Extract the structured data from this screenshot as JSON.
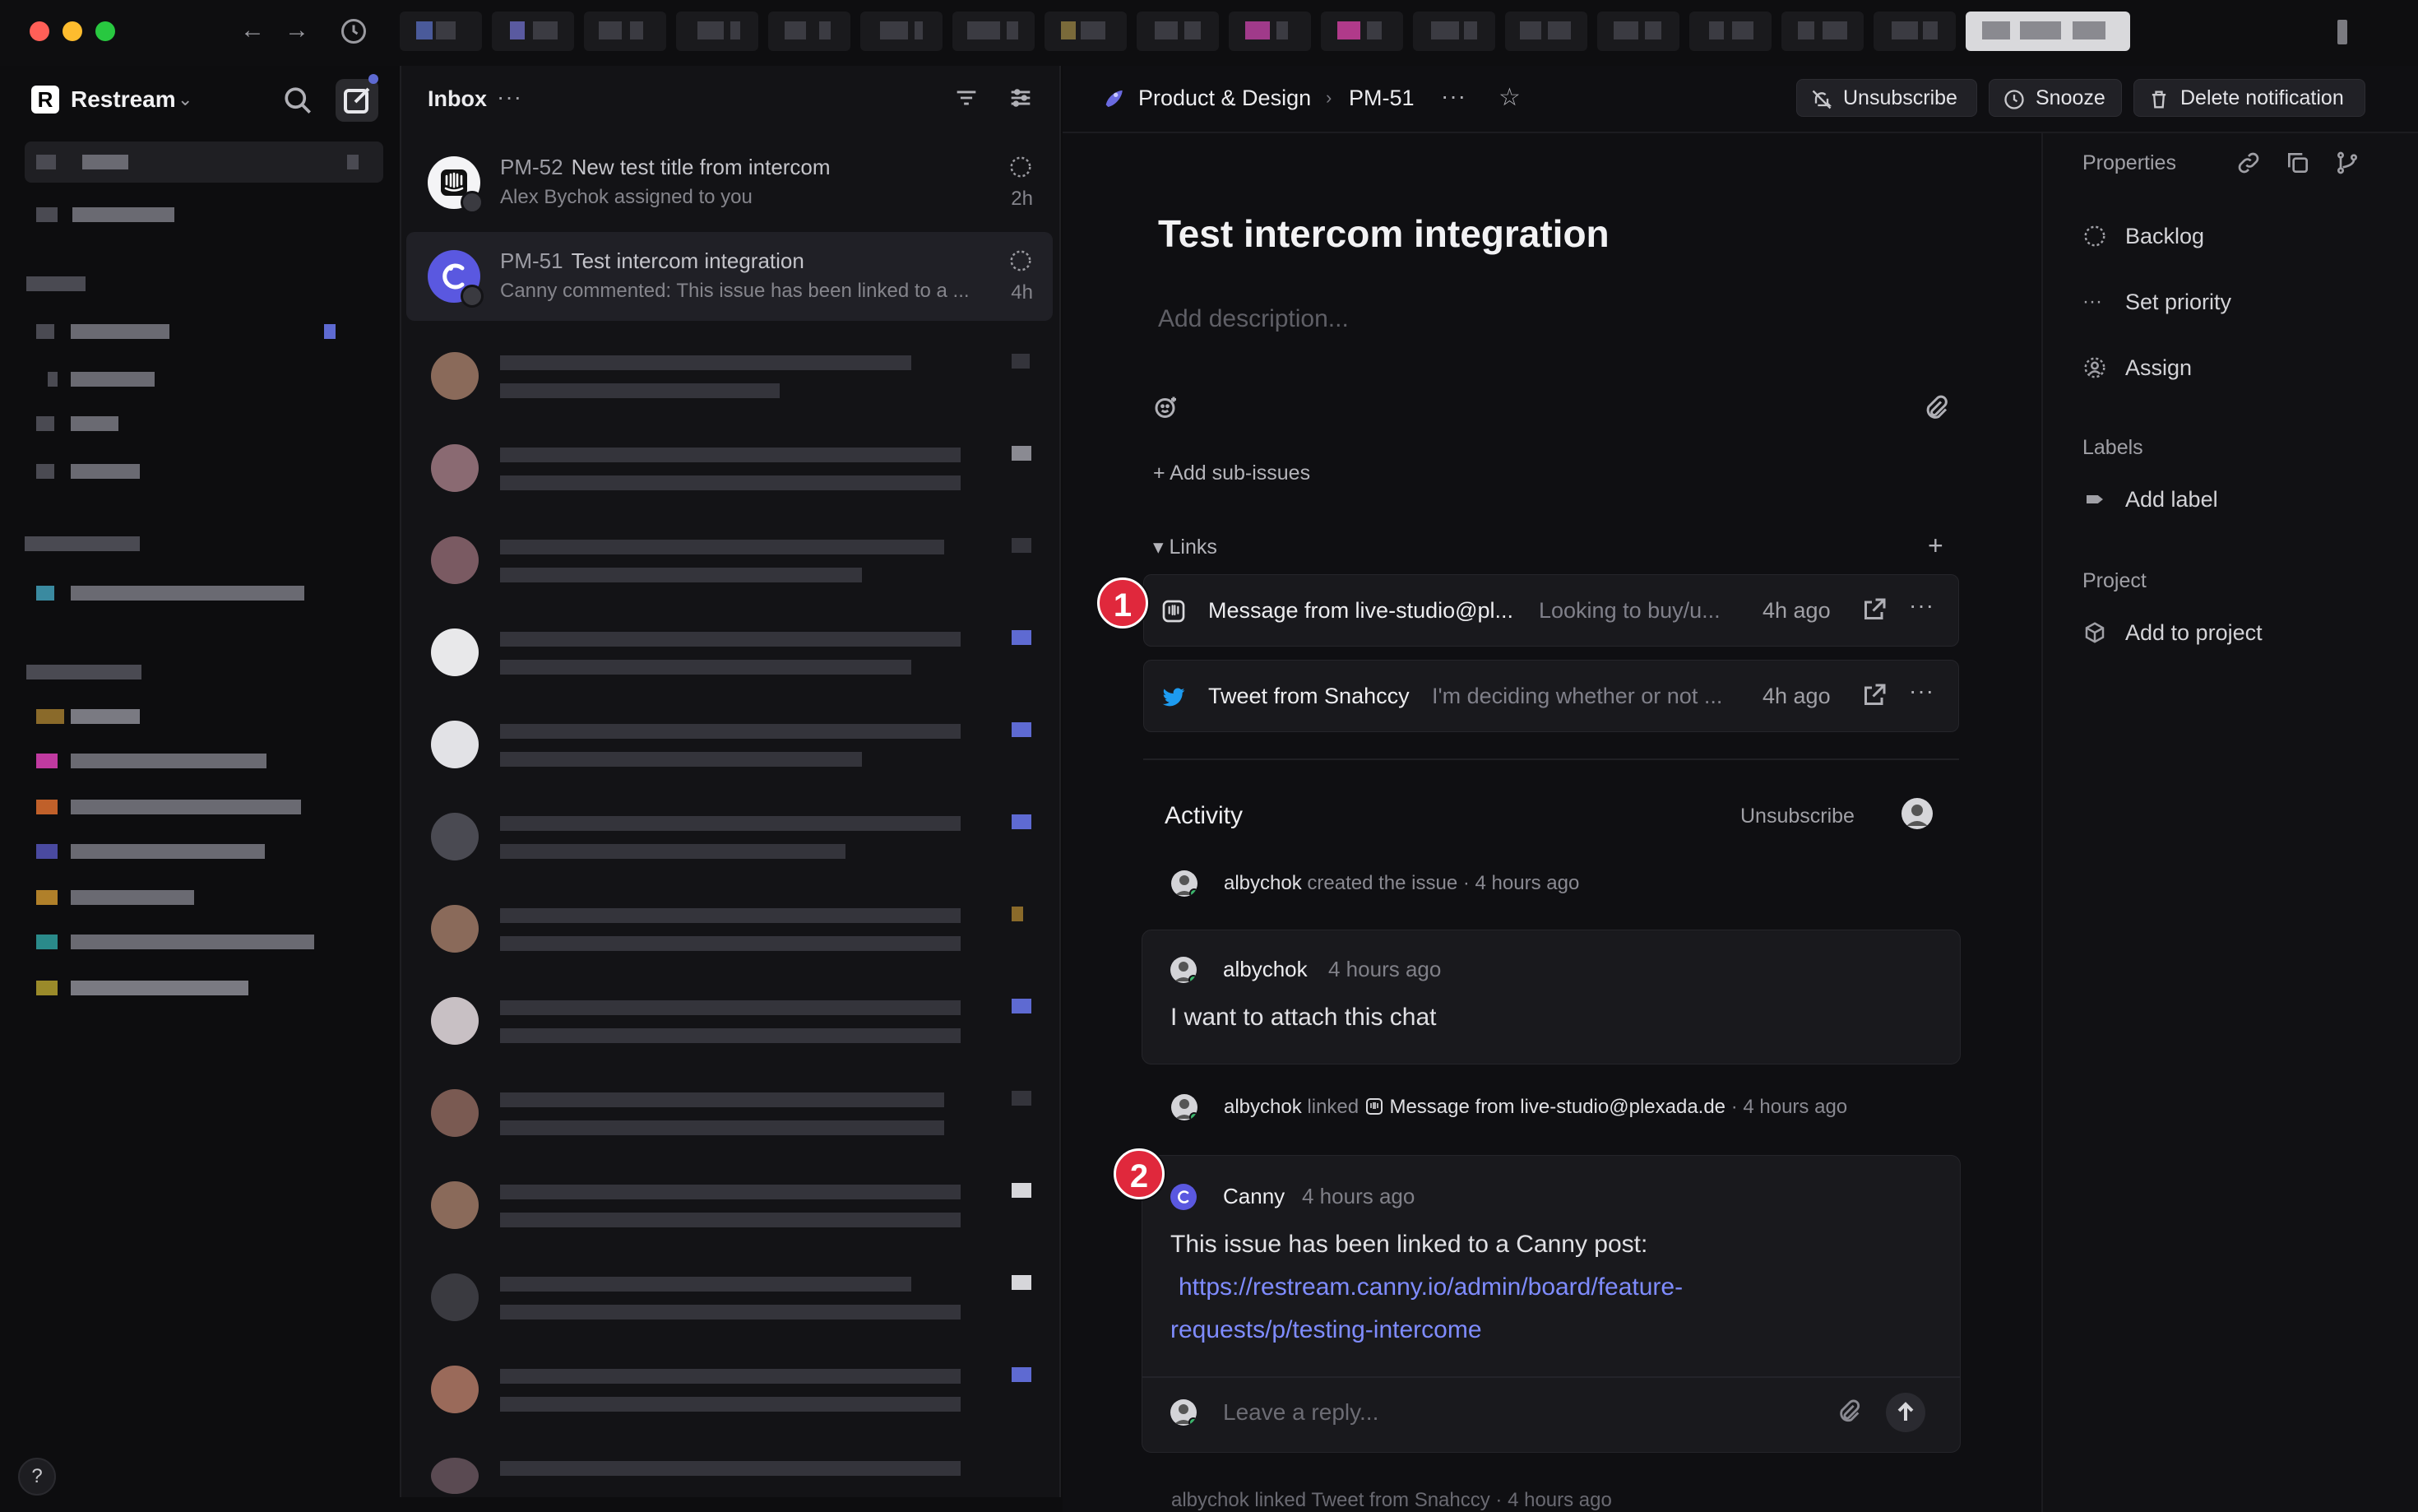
{
  "sidebar": {
    "workspace_initial": "R",
    "workspace_name": "Restream",
    "help_label": "?"
  },
  "inbox": {
    "title": "Inbox",
    "more_label": "···",
    "items": [
      {
        "id": "PM-52",
        "title": "New test title from intercom",
        "subtitle": "Alex Bychok assigned to you",
        "time": "2h"
      },
      {
        "id": "PM-51",
        "title": "Test intercom integration",
        "subtitle": "Canny commented: This issue has been linked to a ...",
        "time": "4h"
      }
    ]
  },
  "issue": {
    "breadcrumb_team": "Product & Design",
    "breadcrumb_sep": "›",
    "breadcrumb_id": "PM-51",
    "more_label": "···",
    "actions": {
      "unsubscribe": "Unsubscribe",
      "snooze": "Snooze",
      "delete": "Delete notification"
    },
    "title": "Test intercom integration",
    "description_placeholder": "Add description...",
    "add_sub_issues": "+ Add sub-issues",
    "links_header": "▾ Links",
    "links_add": "+",
    "links": [
      {
        "title": "Message from live-studio@pl...",
        "subtitle": "Looking to buy/u...",
        "time": "4h ago"
      },
      {
        "title": "Tweet from Snahccy",
        "subtitle": "I'm deciding whether or not ...",
        "time": "4h ago"
      }
    ],
    "markers": [
      "1",
      "2"
    ],
    "activity": {
      "title": "Activity",
      "unsubscribe": "Unsubscribe",
      "created": {
        "user": "albychok",
        "action": "created the issue",
        "dot": "·",
        "time": "4 hours ago"
      },
      "comment1": {
        "user": "albychok",
        "time": "4 hours ago",
        "body": "I want to attach this chat"
      },
      "linked": {
        "user": "albychok",
        "action": "linked",
        "target": "Message from live-studio@plexada.de",
        "dot": "·",
        "time": "4 hours ago"
      },
      "comment2": {
        "user": "Canny",
        "time": "4 hours ago",
        "body": "This issue has been linked to a Canny post:",
        "link_line1": "https://restream.canny.io/admin/board/feature-",
        "link_line2": "requests/p/testing-intercome"
      },
      "reply_placeholder": "Leave a reply...",
      "next_row": "albychok linked  Tweet from Snahccy · 4 hours ago"
    }
  },
  "properties": {
    "title": "Properties",
    "status": "Backlog",
    "priority": "Set priority",
    "assign": "Assign",
    "labels_title": "Labels",
    "add_label": "Add label",
    "project_title": "Project",
    "add_to_project": "Add to project"
  },
  "colors": {
    "accent": "#5e6ad2",
    "marker": "#e0283c",
    "link": "#7f8cff",
    "twitter": "#1d9bf0"
  }
}
